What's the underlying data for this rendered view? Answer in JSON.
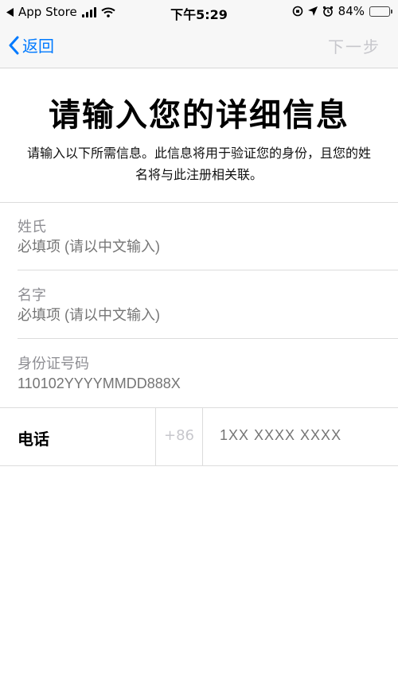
{
  "status_bar": {
    "back_app": "App Store",
    "time": "下午5:29",
    "battery_percent": "84%",
    "battery_level": 0.84,
    "battery_color": "#4cd964"
  },
  "nav": {
    "back_label": "返回",
    "next_label": "下一步",
    "accent_color": "#007aff"
  },
  "header": {
    "title": "请输入您的详细信息",
    "subtitle": "请输入以下所需信息。此信息将用于验证您的身份，且您的姓名将与此注册相关联。"
  },
  "form": {
    "surname": {
      "label": "姓氏",
      "placeholder": "必填项 (请以中文输入)"
    },
    "given_name": {
      "label": "名字",
      "placeholder": "必填项 (请以中文输入)"
    },
    "id_number": {
      "label": "身份证号码",
      "placeholder": "110102YYYYMMDD888X"
    },
    "phone": {
      "label": "电话",
      "country_code": "+86",
      "placeholder": "1XX XXXX XXXX"
    }
  }
}
